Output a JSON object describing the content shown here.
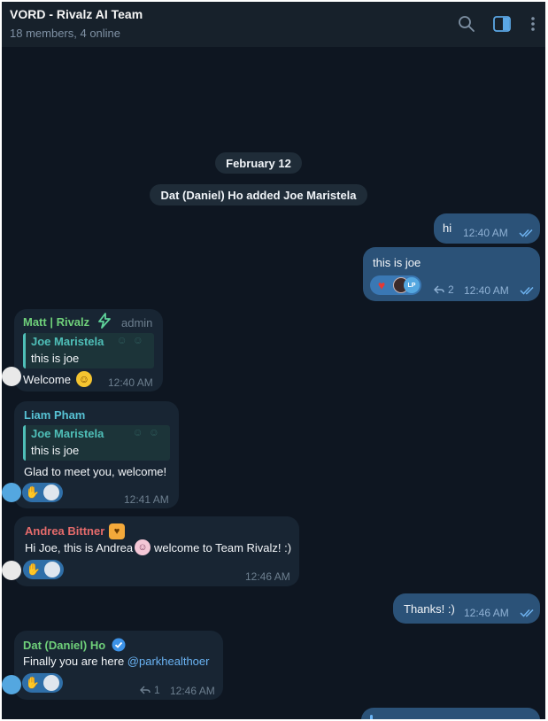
{
  "header": {
    "title": "VORD - Rivalz AI Team",
    "subtitle": "18 members, 4 online"
  },
  "date_separator": "February 12",
  "service_message": "Dat (Daniel) Ho added Joe Maristela",
  "messages": [
    {
      "text": "hi",
      "time": "12:40 AM"
    },
    {
      "text": "this is joe",
      "time": "12:40 AM",
      "reply_count": "2",
      "avatar_initials": "LP"
    },
    {
      "sender": "Matt | Rivalz",
      "role": "admin",
      "quote_name": "Joe Maristela",
      "quote_text": "this is joe",
      "text": "Welcome",
      "time": "12:40 AM"
    },
    {
      "sender": "Liam Pham",
      "quote_name": "Joe Maristela",
      "quote_text": "this is joe",
      "text": "Glad to meet you, welcome!",
      "time": "12:41 AM"
    },
    {
      "sender": "Andrea Bittner",
      "text_before": "Hi Joe, this is Andrea",
      "text_after": "welcome to Team Rivalz! :)",
      "time": "12:46 AM"
    },
    {
      "text": "Thanks! :)",
      "time": "12:46 AM"
    },
    {
      "sender": "Dat (Daniel) Ho",
      "text_before": "Finally you are here ",
      "mention": "@parkhealthoer",
      "time": "12:46 AM",
      "reply_count": "1"
    }
  ],
  "colors": {
    "background": "#0e1621",
    "header": "#17212b",
    "outgoing_bubble": "#2b5278",
    "incoming_bubble": "#182533",
    "sender_green": "#6fd07a",
    "sender_teal": "#57c2d4",
    "sender_red": "#e56b6b",
    "link": "#6ab3f3"
  },
  "icons": [
    "search-icon",
    "sidebar-toggle-icon",
    "more-vertical-icon",
    "double-check-icon",
    "reply-arrow-icon",
    "verified-badge-icon"
  ]
}
